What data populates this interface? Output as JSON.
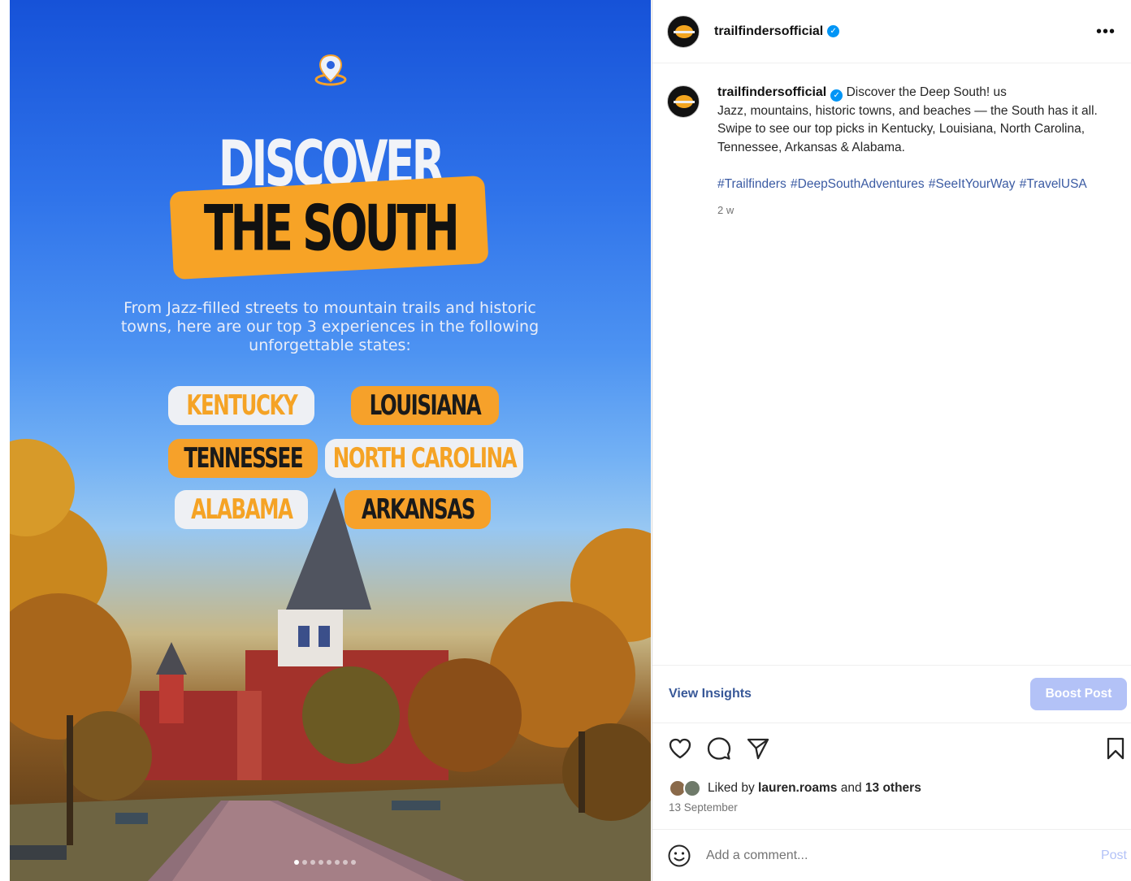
{
  "post": {
    "username": "trailfindersofficial",
    "more_icon": "more-options-icon",
    "image": {
      "headline_line1": "DISCOVER",
      "headline_line2": "THE SOUTH",
      "subcopy": "From Jazz-filled streets to mountain trails and historic towns, here are our top 3 experiences in the following unforgettable states:",
      "states": [
        "KENTUCKY",
        "LOUISIANA",
        "TENNESSEE",
        "NORTH CAROLINA",
        "ALABAMA",
        "ARKANSAS"
      ],
      "accent_color": "#f6a12a",
      "carousel_count": 8,
      "carousel_active": 1
    },
    "caption": {
      "username": "trailfindersofficial",
      "text_line1": "Discover the Deep South! us",
      "text_rest": "Jazz, mountains, historic towns, and beaches — the South has it all. Swipe to see our top picks in Kentucky, Louisiana, North Carolina, Tennessee, Arkansas & Alabama.",
      "hashtags": "#Trailfinders #DeepSouthAdventures #SeeItYourWay #TravelUSA",
      "age": "2 w"
    },
    "insights": {
      "view_label": "View Insights",
      "boost_label": "Boost Post"
    },
    "likes": {
      "prefix": "Liked by",
      "user": "lauren.roams",
      "conj": "and",
      "others": "13 others"
    },
    "date": "13 September",
    "comment": {
      "placeholder": "Add a comment...",
      "post_label": "Post"
    }
  }
}
